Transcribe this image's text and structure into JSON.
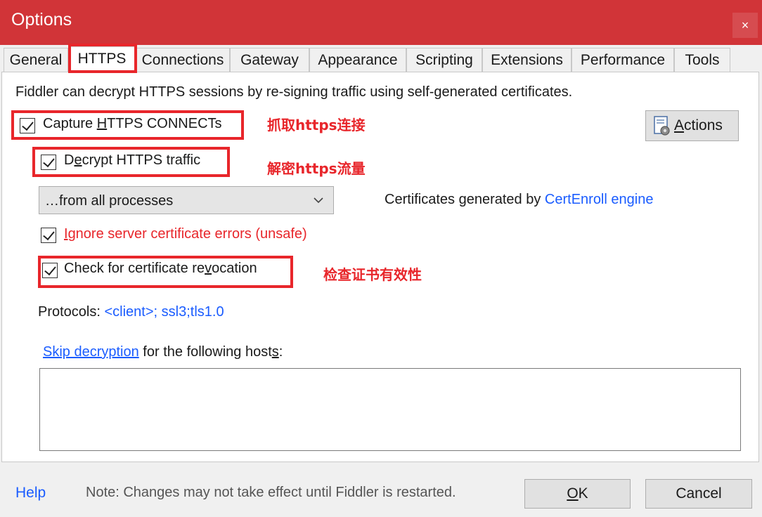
{
  "window": {
    "title": "Options",
    "close_glyph": "×"
  },
  "tabs": [
    {
      "label": "General"
    },
    {
      "label": "HTTPS"
    },
    {
      "label": "Connections"
    },
    {
      "label": "Gateway"
    },
    {
      "label": "Appearance"
    },
    {
      "label": "Scripting"
    },
    {
      "label": "Extensions"
    },
    {
      "label": "Performance"
    },
    {
      "label": "Tools"
    }
  ],
  "active_tab": "HTTPS",
  "https_panel": {
    "description": "Fiddler can decrypt HTTPS sessions by re-signing traffic using self-generated certificates.",
    "capture_connects": {
      "label_pre": "Capture ",
      "label_key": "H",
      "label_post": "TTPS CONNECTs",
      "checked": true
    },
    "decrypt_traffic": {
      "label_pre": "D",
      "label_key": "e",
      "label_post": "crypt HTTPS traffic",
      "checked": true
    },
    "process_filter": {
      "selected": "…from all processes"
    },
    "cert_generator": {
      "prefix": "Certificates generated by ",
      "link": "CertEnroll engine"
    },
    "ignore_errors": {
      "label_key": "I",
      "label_post": "gnore server certificate errors (unsafe)",
      "checked": true
    },
    "check_revocation": {
      "label_pre": "Check for certificate re",
      "label_key": "v",
      "label_post": "ocation",
      "checked": true
    },
    "protocols": {
      "prefix": "Protocols: ",
      "link": "<client>; ssl3;tls1.0"
    },
    "skip_decryption": {
      "link": "Skip decryption",
      "text_pre": " for the following host",
      "text_key": "s",
      "text_post": ":"
    },
    "hosts_value": "",
    "actions_button": {
      "label_key": "A",
      "label_post": "ctions",
      "icon": "certificate-gear-icon"
    }
  },
  "annotations": {
    "capture": "抓取https连接",
    "decrypt": "解密https流量",
    "revocation": "检查证书有效性",
    "color": "#e8262b"
  },
  "footer": {
    "help": "Help",
    "note": "Note: Changes may not take effect until Fiddler is restarted.",
    "ok_key": "O",
    "ok_post": "K",
    "cancel": "Cancel"
  },
  "colors": {
    "titlebar": "#d13438",
    "link": "#1a5cff",
    "annotation": "#e8262b"
  }
}
